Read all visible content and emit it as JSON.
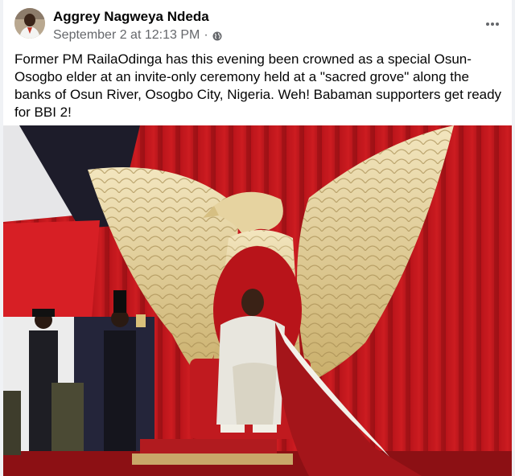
{
  "post": {
    "author": "Aggrey Nagweya Ndeda",
    "timestamp": "September 2 at 12:13 PM",
    "separator": "·",
    "audience_icon": "globe-icon",
    "more_icon": "more-options-icon",
    "text": "Former PM RailaOdinga has this evening been crowned as a special Osun-Osogbo elder at an invite-only ceremony held at a \"sacred grove\" along the banks of Osun River, Osogbo City, Nigeria. Weh! Babaman supporters get ready for BBI 2!"
  },
  "colors": {
    "author_text": "#050505",
    "meta_text": "#65676b",
    "background": "#f0f2f5",
    "card": "#ffffff",
    "curtain_red": "#c4161c",
    "gold": "#d9c48a"
  }
}
